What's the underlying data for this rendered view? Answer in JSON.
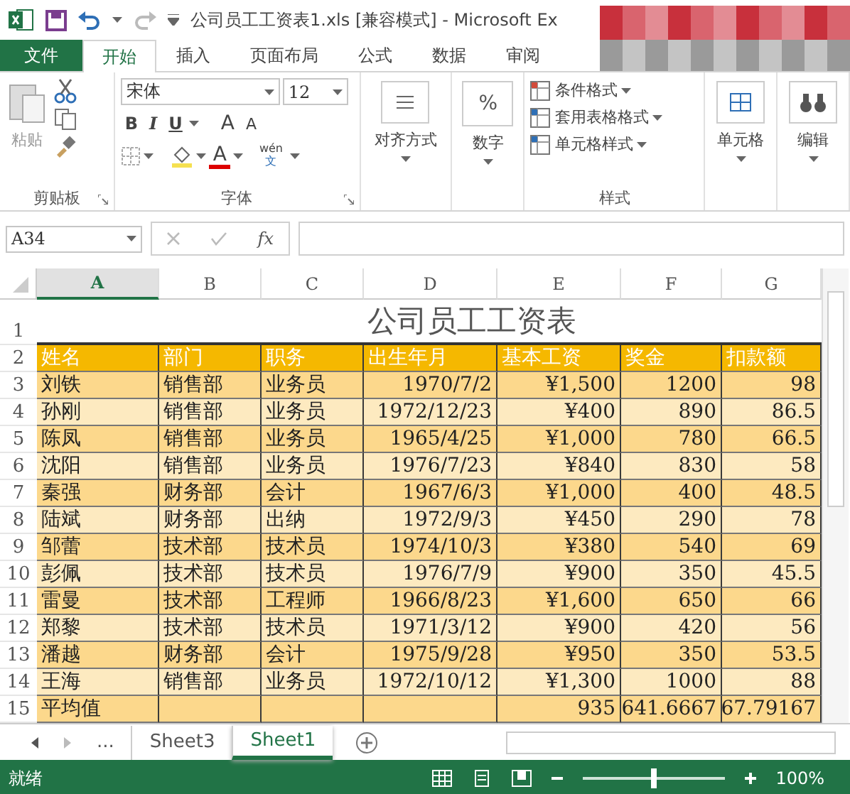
{
  "title_bar": {
    "document_title": "公司员工工资表1.xls  [兼容模式] - Microsoft Ex"
  },
  "ribbon_tabs": [
    {
      "label": "文件",
      "kind": "file",
      "selected": false
    },
    {
      "label": "开始",
      "kind": "tab",
      "selected": true
    },
    {
      "label": "插入",
      "kind": "tab",
      "selected": false
    },
    {
      "label": "页面布局",
      "kind": "tab",
      "selected": false
    },
    {
      "label": "公式",
      "kind": "tab",
      "selected": false
    },
    {
      "label": "数据",
      "kind": "tab",
      "selected": false
    },
    {
      "label": "审阅",
      "kind": "tab",
      "selected": false
    }
  ],
  "ribbon": {
    "clipboard": {
      "paste_label": "粘贴",
      "group_label": "剪贴板"
    },
    "font": {
      "font_name": "宋体",
      "font_size": "12",
      "bold": "B",
      "italic": "I",
      "underline": "U",
      "grow": "A",
      "shrink": "A",
      "font_color": "A",
      "phonetic_top": "wén",
      "phonetic_bottom": "文",
      "group_label": "字体"
    },
    "alignment": {
      "label": "对齐方式"
    },
    "number": {
      "symbol": "%",
      "label": "数字"
    },
    "styles": {
      "items": [
        "条件格式",
        "套用表格格式",
        "单元格样式"
      ],
      "group_label": "样式"
    },
    "cells": {
      "label": "单元格"
    },
    "editing": {
      "label": "编辑"
    }
  },
  "formula_bar": {
    "name_box": "A34",
    "function_symbol": "fx"
  },
  "sheet": {
    "columns": [
      {
        "label": "A",
        "selected": true
      },
      {
        "label": "B",
        "selected": false
      },
      {
        "label": "C",
        "selected": false
      },
      {
        "label": "D",
        "selected": false
      },
      {
        "label": "E",
        "selected": false
      },
      {
        "label": "F",
        "selected": false
      },
      {
        "label": "G",
        "selected": false
      }
    ],
    "title_row": "1",
    "header_row": "2",
    "title": "公司员工工资表",
    "header": [
      "姓名",
      "部门",
      "职务",
      "出生年月",
      "基本工资",
      "奖金",
      "扣款额"
    ],
    "rows": [
      {
        "number": "3",
        "cells": [
          "刘铁",
          "销售部",
          "业务员",
          "1970/7/2",
          "¥1,500",
          "1200",
          "98"
        ]
      },
      {
        "number": "4",
        "cells": [
          "孙刚",
          "销售部",
          "业务员",
          "1972/12/23",
          "¥400",
          "890",
          "86.5"
        ]
      },
      {
        "number": "5",
        "cells": [
          "陈凤",
          "销售部",
          "业务员",
          "1965/4/25",
          "¥1,000",
          "780",
          "66.5"
        ]
      },
      {
        "number": "6",
        "cells": [
          "沈阳",
          "销售部",
          "业务员",
          "1976/7/23",
          "¥840",
          "830",
          "58"
        ]
      },
      {
        "number": "7",
        "cells": [
          "秦强",
          "财务部",
          "会计",
          "1967/6/3",
          "¥1,000",
          "400",
          "48.5"
        ]
      },
      {
        "number": "8",
        "cells": [
          "陆斌",
          "财务部",
          "出纳",
          "1972/9/3",
          "¥450",
          "290",
          "78"
        ]
      },
      {
        "number": "9",
        "cells": [
          "邹蕾",
          "技术部",
          "技术员",
          "1974/10/3",
          "¥380",
          "540",
          "69"
        ]
      },
      {
        "number": "10",
        "cells": [
          "彭佩",
          "技术部",
          "技术员",
          "1976/7/9",
          "¥900",
          "350",
          "45.5"
        ]
      },
      {
        "number": "11",
        "cells": [
          "雷曼",
          "技术部",
          "工程师",
          "1966/8/23",
          "¥1,600",
          "650",
          "66"
        ]
      },
      {
        "number": "12",
        "cells": [
          "郑黎",
          "技术部",
          "技术员",
          "1971/3/12",
          "¥900",
          "420",
          "56"
        ]
      },
      {
        "number": "13",
        "cells": [
          "潘越",
          "财务部",
          "会计",
          "1975/9/28",
          "¥950",
          "350",
          "53.5"
        ]
      },
      {
        "number": "14",
        "cells": [
          "王海",
          "销售部",
          "业务员",
          "1972/10/12",
          "¥1,300",
          "1000",
          "88"
        ]
      },
      {
        "number": "15",
        "cells": [
          "平均值",
          "",
          "",
          "",
          "935",
          "641.6667",
          "67.79167"
        ]
      }
    ]
  },
  "sheet_tabs": {
    "overflow": "...",
    "tabs": [
      {
        "label": "Sheet3",
        "selected": false
      },
      {
        "label": "Sheet1",
        "selected": true
      }
    ]
  },
  "status_bar": {
    "status": "就绪",
    "zoom": {
      "level": 0.5,
      "reading": "100%"
    }
  }
}
